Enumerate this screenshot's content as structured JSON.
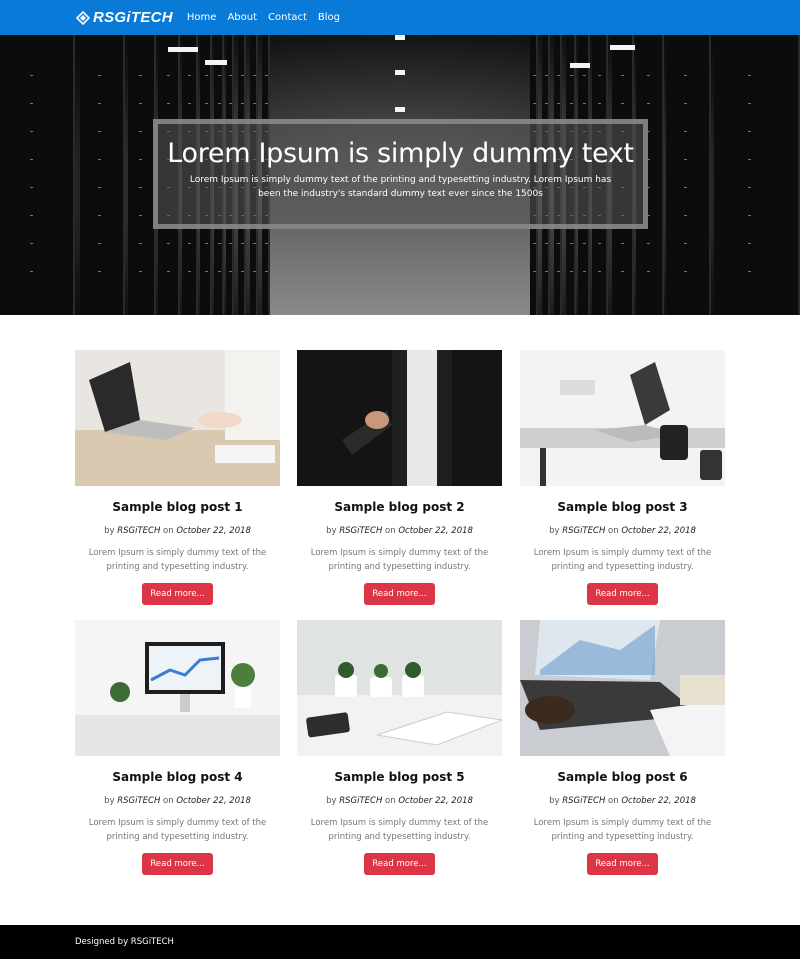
{
  "navbar": {
    "brand": "RSGiTECH",
    "links": [
      "Home",
      "About",
      "Contact",
      "Blog"
    ],
    "color": "#0a7ad9"
  },
  "hero": {
    "title": "Lorem Ipsum is simply dummy text",
    "subtitle": "Lorem Ipsum is simply dummy text of the printing and typesetting industry. Lorem Ipsum has been the industry's standard dummy text ever since the 1500s"
  },
  "posts": [
    {
      "title": "Sample blog post 1",
      "by": "by",
      "author": "RSGiTECH",
      "on": "on",
      "date": "October 22, 2018",
      "excerpt": "Lorem Ipsum is simply dummy text of the printing and typesetting industry.",
      "button": "Read more...",
      "image": "laptop-desk"
    },
    {
      "title": "Sample blog post 2",
      "by": "by",
      "author": "RSGiTECH",
      "on": "on",
      "date": "October 22, 2018",
      "excerpt": "Lorem Ipsum is simply dummy text of the printing and typesetting industry.",
      "button": "Read more...",
      "image": "handshake"
    },
    {
      "title": "Sample blog post 3",
      "by": "by",
      "author": "RSGiTECH",
      "on": "on",
      "date": "October 22, 2018",
      "excerpt": "Lorem Ipsum is simply dummy text of the printing and typesetting industry.",
      "button": "Read more...",
      "image": "laptop-camera"
    },
    {
      "title": "Sample blog post 4",
      "by": "by",
      "author": "RSGiTECH",
      "on": "on",
      "date": "October 22, 2018",
      "excerpt": "Lorem Ipsum is simply dummy text of the printing and typesetting industry.",
      "button": "Read more...",
      "image": "imac-desk"
    },
    {
      "title": "Sample blog post 5",
      "by": "by",
      "author": "RSGiTECH",
      "on": "on",
      "date": "October 22, 2018",
      "excerpt": "Lorem Ipsum is simply dummy text of the printing and typesetting industry.",
      "button": "Read more...",
      "image": "plants-notebook"
    },
    {
      "title": "Sample blog post 6",
      "by": "by",
      "author": "RSGiTECH",
      "on": "on",
      "date": "October 22, 2018",
      "excerpt": "Lorem Ipsum is simply dummy text of the printing and typesetting industry.",
      "button": "Read more...",
      "image": "laptop-charts"
    }
  ],
  "footer": {
    "text": "Designed by RSGiTECH"
  }
}
